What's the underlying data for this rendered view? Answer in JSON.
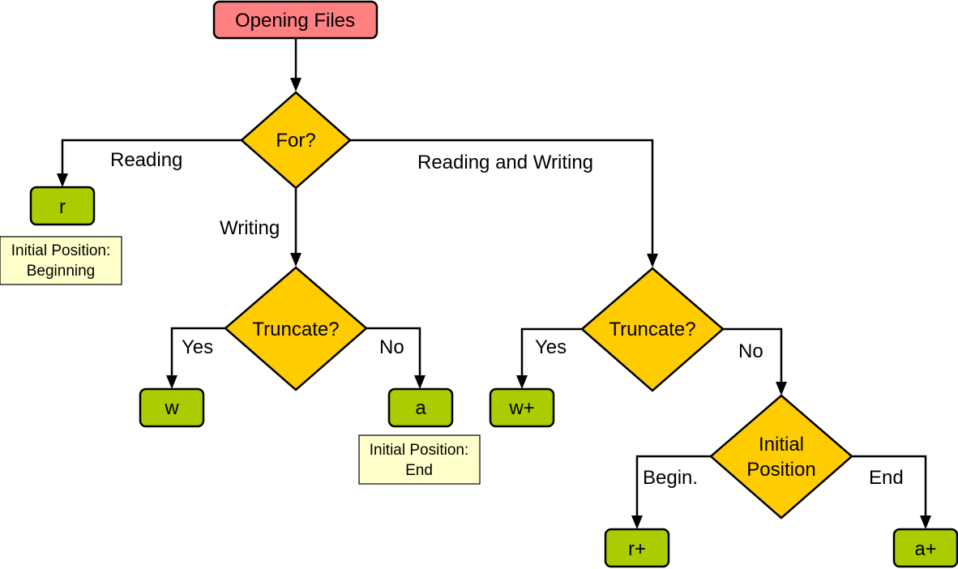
{
  "title": "Opening Files",
  "colors": {
    "start": "#ff8080",
    "decision": "#ffcc00",
    "terminal": "#aacc00",
    "note": "#ffffcc"
  },
  "nodes": {
    "start": "Opening Files",
    "for": "For?",
    "truncate_w": "Truncate?",
    "truncate_rw": "Truncate?",
    "initpos_line1": "Initial",
    "initpos_line2": "Position",
    "r": "r",
    "w": "w",
    "a": "a",
    "wplus": "w+",
    "rplus": "r+",
    "aplus": "a+"
  },
  "edges": {
    "reading": "Reading",
    "writing": "Writing",
    "reading_writing": "Reading and Writing",
    "yes_w": "Yes",
    "no_w": "No",
    "yes_rw": "Yes",
    "no_rw": "No",
    "begin": "Begin.",
    "end": "End"
  },
  "notes": {
    "r_line1": "Initial Position:",
    "r_line2": "Beginning",
    "a_line1": "Initial Position:",
    "a_line2": "End"
  }
}
